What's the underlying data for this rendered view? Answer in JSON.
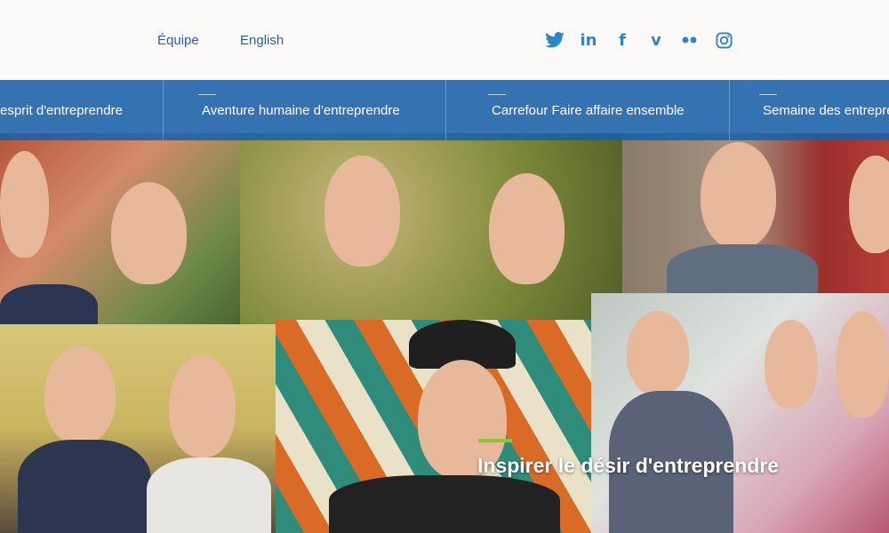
{
  "header": {
    "links": [
      {
        "label": "Équipe"
      },
      {
        "label": "English"
      }
    ],
    "social": [
      {
        "name": "twitter-icon",
        "glyph": "🐦"
      },
      {
        "name": "linkedin-icon",
        "glyph": "in"
      },
      {
        "name": "facebook-icon",
        "glyph": "f"
      },
      {
        "name": "vimeo-icon",
        "glyph": "v"
      },
      {
        "name": "flickr-icon",
        "glyph": "••"
      },
      {
        "name": "instagram-icon",
        "glyph": "◻"
      }
    ]
  },
  "nav": {
    "items": [
      {
        "label": "esprit d'entreprendre"
      },
      {
        "label": "Aventure humaine d'entreprendre"
      },
      {
        "label": "Carrefour Faire affaire ensemble"
      },
      {
        "label": "Semaine des entrepre"
      }
    ]
  },
  "hero": {
    "caption": "Inspirer le désir d'entreprendre"
  },
  "colors": {
    "nav_bg": "#175faa",
    "accent_green": "#8fc43a",
    "link_blue": "#2e5c8f",
    "social_blue": "#2e86c8"
  }
}
